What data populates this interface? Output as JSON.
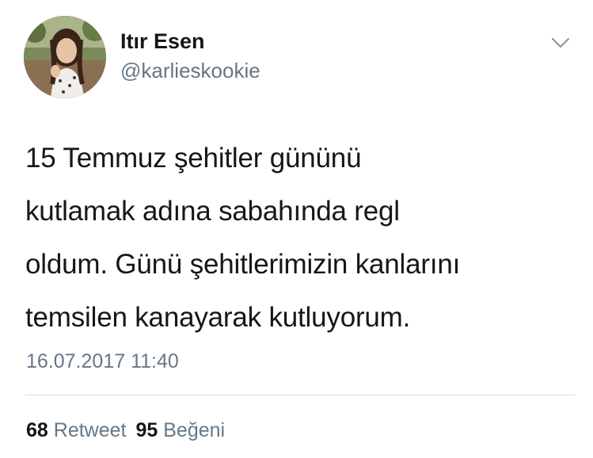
{
  "user": {
    "display_name": "Itır Esen",
    "handle": "@karlieskookie",
    "avatar_icon": "profile-photo"
  },
  "menu": {
    "icon": "chevron-down-icon"
  },
  "tweet": {
    "text": "15 Temmuz şehitler gününü\nkutlamak adına sabahında regl\noldum. Günü şehitlerimizin kanlarını\ntemsilen kanayarak kutluyorum.",
    "timestamp": "16.07.2017 11:40"
  },
  "stats": {
    "retweet_count": "68",
    "retweet_label": "Retweet",
    "like_count": "95",
    "like_label": "Beğeni"
  },
  "colors": {
    "text_primary": "#14171a",
    "text_secondary": "#657786",
    "divider": "#d9dee2",
    "background": "#ffffff"
  }
}
